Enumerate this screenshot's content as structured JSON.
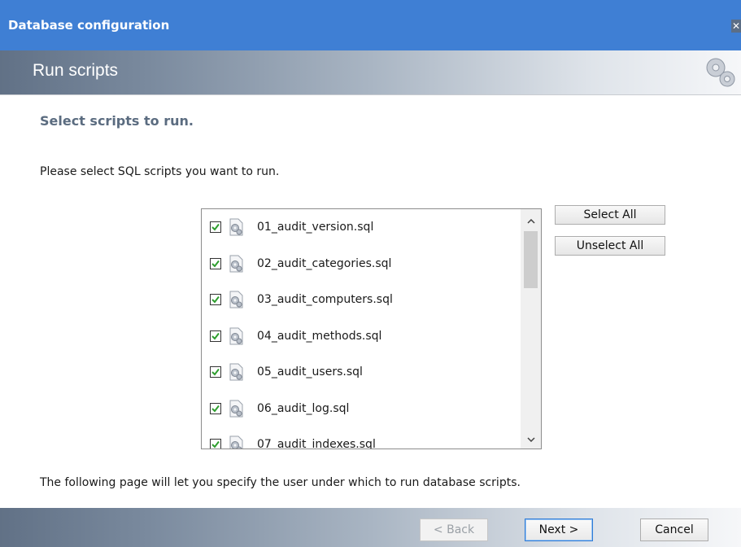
{
  "window": {
    "title": "Database configuration",
    "close_label": "✕"
  },
  "header": {
    "title": "Run scripts",
    "icon": "gears-icon"
  },
  "main": {
    "heading": "Select scripts to run.",
    "instruction": "Please select SQL scripts you want to run.",
    "scripts": [
      {
        "name": "01_audit_version.sql",
        "checked": true
      },
      {
        "name": "02_audit_categories.sql",
        "checked": true
      },
      {
        "name": "03_audit_computers.sql",
        "checked": true
      },
      {
        "name": "04_audit_methods.sql",
        "checked": true
      },
      {
        "name": "05_audit_users.sql",
        "checked": true
      },
      {
        "name": "06_audit_log.sql",
        "checked": true
      },
      {
        "name": "07_audit_indexes.sql",
        "checked": true
      }
    ],
    "select_all_label": "Select All",
    "unselect_all_label": "Unselect All",
    "footnote": "The following page will let you specify the user under which to run database scripts."
  },
  "footer": {
    "back_label": "< Back",
    "next_label": "Next >",
    "cancel_label": "Cancel"
  },
  "colors": {
    "titlebar": "#3f7fd4",
    "heading": "#5b6c80",
    "checkmark": "#2e9e2e"
  }
}
